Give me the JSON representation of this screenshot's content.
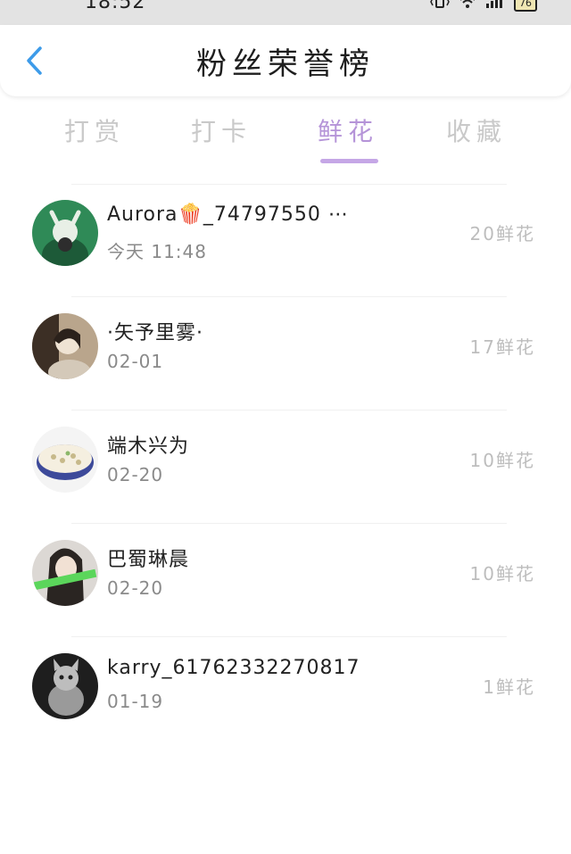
{
  "status_bar": {
    "time": "18:52",
    "battery": "76"
  },
  "header": {
    "title": "粉丝荣誉榜"
  },
  "tabs": [
    {
      "label": "打赏"
    },
    {
      "label": "打卡"
    },
    {
      "label": "鲜花"
    },
    {
      "label": "收藏"
    }
  ],
  "active_tab": "鲜花",
  "colors": {
    "accent": "#c5a7e6",
    "back_icon": "#3d9be9"
  },
  "rows": [
    {
      "name": "Aurora🍿_74797550 ⋯",
      "date": "今天 11:48",
      "amount": "20鲜花"
    },
    {
      "name": "·矢予里雾·",
      "date": "02-01",
      "amount": "17鲜花"
    },
    {
      "name": "端木兴为",
      "date": "02-20",
      "amount": "10鲜花"
    },
    {
      "name": "巴蜀琳晨",
      "date": "02-20",
      "amount": "10鲜花"
    },
    {
      "name": "karry_61762332270817",
      "date": "01-19",
      "amount": "1鲜花"
    }
  ]
}
